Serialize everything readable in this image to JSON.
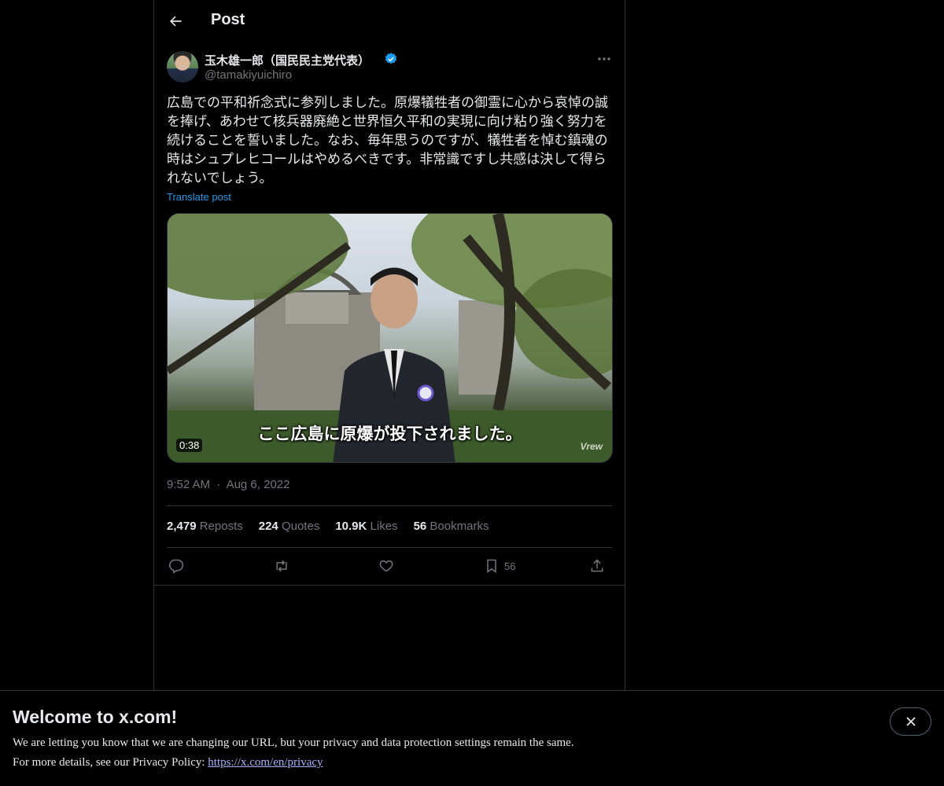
{
  "header": {
    "title": "Post"
  },
  "author": {
    "name": "玉木雄一郎（国民民主党代表）",
    "handle": "@tamakiyuichiro"
  },
  "post": {
    "text": "広島での平和祈念式に参列しました。原爆犠牲者の御霊に心から哀悼の誠\nを捧げ、あわせて核兵器廃絶と世界恒久平和の実現に向け粘り強く努力を\n続けることを誓いました。なお、毎年思うのですが、犠牲者を悼む鎮魂の\n時はシュプレヒコールはやめるべきです。非常識ですし共感は決して得ら\nれないでしょう。",
    "translate_label": "Translate post",
    "video": {
      "subtitle": "ここ広島に原爆が投下されました。",
      "duration": "0:38",
      "watermark": "Vrew"
    },
    "time": "9:52 AM",
    "date": "Aug 6, 2022",
    "separator": "·"
  },
  "stats": [
    {
      "count": "2,479",
      "label": "Reposts"
    },
    {
      "count": "224",
      "label": "Quotes"
    },
    {
      "count": "10.9K",
      "label": "Likes"
    },
    {
      "count": "56",
      "label": "Bookmarks"
    }
  ],
  "actions": {
    "bookmark_count": "56"
  },
  "colors": {
    "accent": "#1d9bf0",
    "muted": "#71767b",
    "border": "#2f3336",
    "link": "#a8b3ff"
  },
  "banner": {
    "title": "Welcome to x.com!",
    "line1": "We are letting you know that we are changing our URL, but your privacy and data protection settings remain the same.",
    "line2_prefix": "For more details, see our Privacy Policy: ",
    "link": "https://x.com/en/privacy"
  }
}
